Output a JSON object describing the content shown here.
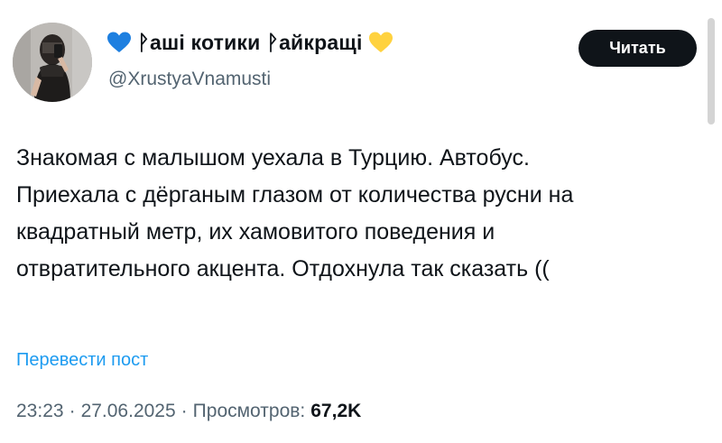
{
  "author": {
    "display_name": "ᚹаші котики ᚹайкращі",
    "handle": "@XrustyaVnamusti",
    "left_icon": "blue-heart-icon",
    "right_icon": "yellow-heart-icon"
  },
  "actions": {
    "subscribe_label": "Читать"
  },
  "tweet": {
    "lines": [
      "Знакомая с малышом уехала в Турцию. Автобус.",
      "Приехала с дёрганым глазом от количества русни на",
      "квадратный метр, их хамовитого поведения и",
      "отвратительного акцента. Отдохнула так сказать (("
    ]
  },
  "translate": {
    "label": "Перевести пост"
  },
  "meta": {
    "time": "23:23",
    "separator": "·",
    "date": "27.06.2025",
    "views_label": "Просмотров:",
    "views_count": "67,2K"
  },
  "colors": {
    "text_primary": "#0f1419",
    "text_secondary": "#536471",
    "link": "#1d9bf0",
    "button_bg": "#0f1419",
    "heart_blue": "#1d7fe0",
    "heart_yellow": "#ffd23f"
  }
}
